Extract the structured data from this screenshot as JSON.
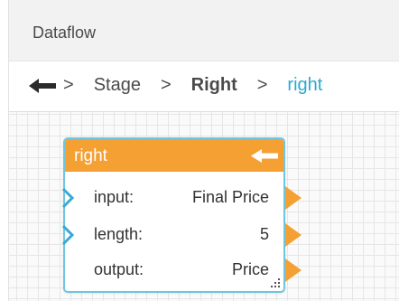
{
  "header": {
    "title": "Dataflow"
  },
  "breadcrumb": {
    "back_icon": "arrow-left-icon",
    "separator": ">",
    "items": [
      {
        "label": "Stage"
      },
      {
        "label": "Right"
      },
      {
        "label": "right"
      }
    ]
  },
  "node": {
    "title": "right",
    "back_icon": "arrow-left-icon",
    "rows": [
      {
        "label": "input:",
        "value": "Final Price"
      },
      {
        "label": "length:",
        "value": "5"
      },
      {
        "label": "output:",
        "value": "Price"
      }
    ]
  },
  "colors": {
    "header_bg": "#f2f2f2",
    "accent_current": "#2ca8d2",
    "node_header": "#f5a033",
    "node_border": "#6fc6e0",
    "port_in": "#3aa9d4",
    "port_out": "#f5a033"
  }
}
